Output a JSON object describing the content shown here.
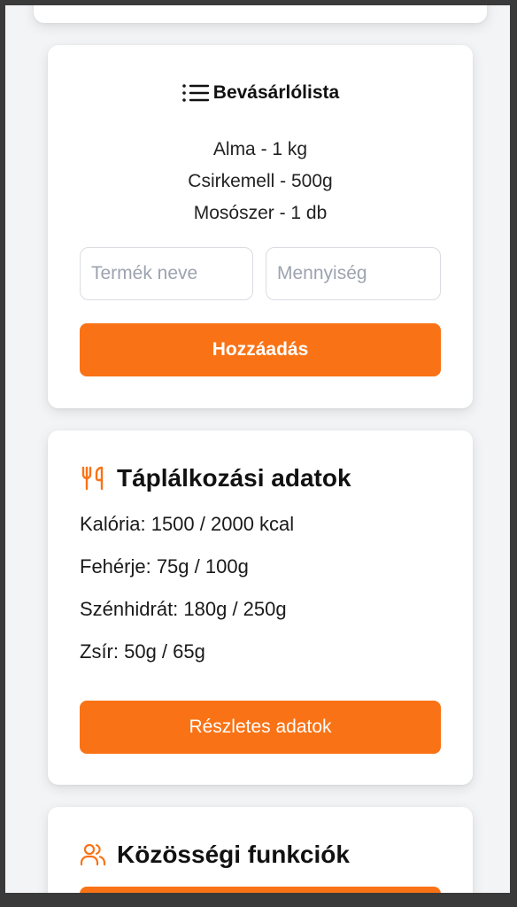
{
  "shopping": {
    "title": "Bevásárlólista",
    "icon": "list-icon",
    "items": [
      "Alma - 1 kg",
      "Csirkemell - 500g",
      "Mosószer - 1 db"
    ],
    "name_placeholder": "Termék neve",
    "qty_placeholder": "Mennyiség",
    "add_label": "Hozzáadás"
  },
  "nutrition": {
    "title": "Táplálkozási adatok",
    "icon": "utensils-icon",
    "rows": [
      "Kalória: 1500 / 2000 kcal",
      "Fehérje: 75g / 100g",
      "Szénhidrát: 180g / 250g",
      "Zsír: 50g / 65g"
    ],
    "details_label": "Részletes adatok"
  },
  "community": {
    "title": "Közösségi funkciók",
    "icon": "users-icon"
  },
  "colors": {
    "accent": "#f97316",
    "card": "#ffffff",
    "background": "#f3f4f6",
    "frame": "#3a3a3a"
  }
}
